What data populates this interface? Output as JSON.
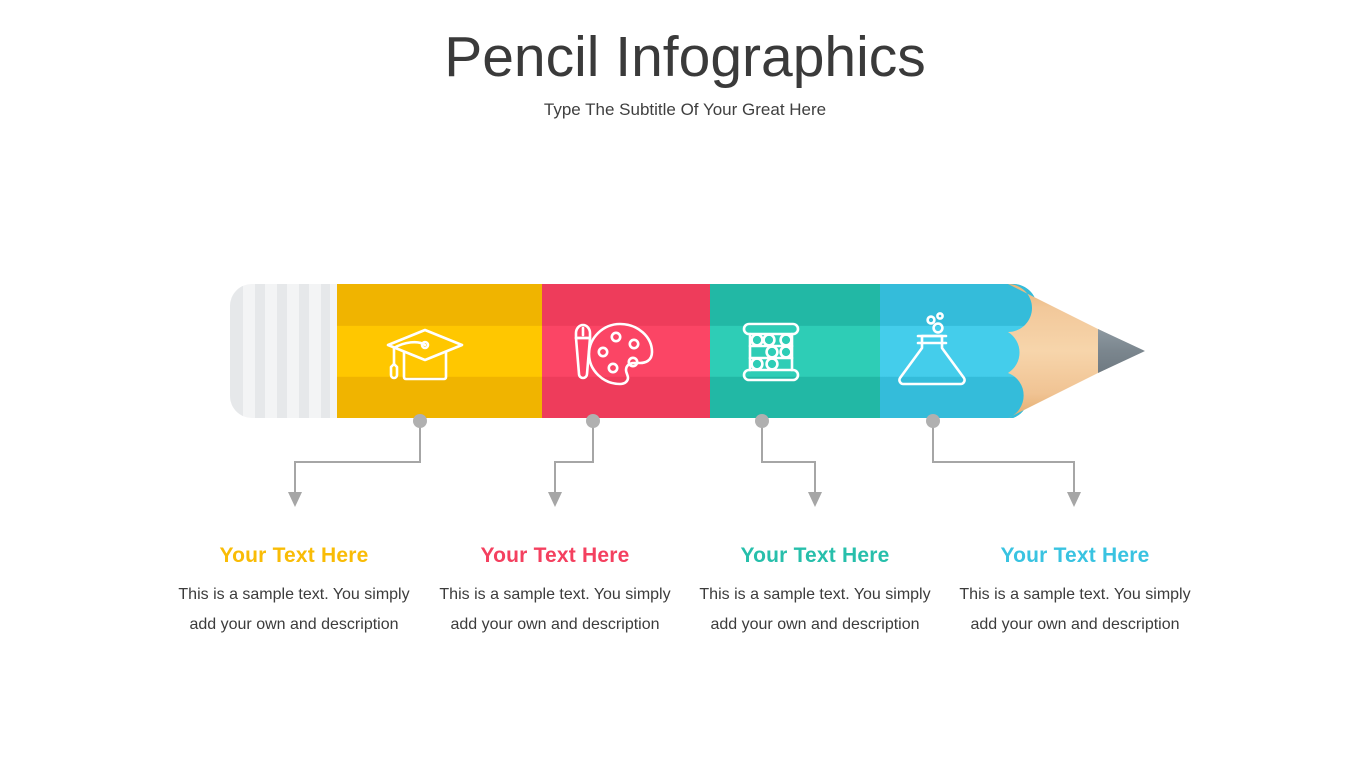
{
  "header": {
    "title": "Pencil Infographics",
    "subtitle": "Type The Subtitle Of Your Great Here"
  },
  "colors": {
    "title_text": "#3a3a3a",
    "subtitle_text": "#3f3f3f",
    "body_text": "#3c3c3c",
    "eraser_light": "#f4f5f6",
    "eraser_dark": "#e2e4e6",
    "yellow": "#f9bc06",
    "yellow_light": "#ffc800",
    "pink": "#f4405f",
    "pink_light": "#fb4363",
    "teal": "#27bfab",
    "teal_light": "#2ecdb6",
    "blue": "#39c3e1",
    "blue_light": "#43cdea",
    "wood": "#efc089",
    "wood_light": "#f6d2a6",
    "graphite": "#7e8b93",
    "connector": "#a6a6a6"
  },
  "pencil": {
    "eraser_label": "pencil-eraser-ferrule",
    "tip_label": "pencil-wood-tip",
    "graphite_label": "pencil-graphite-point",
    "segments": [
      {
        "id": "segment-1",
        "color": "#f9bc06",
        "icon": "graduation-cap-icon"
      },
      {
        "id": "segment-2",
        "color": "#f4405f",
        "icon": "palette-icon"
      },
      {
        "id": "segment-3",
        "color": "#27bfab",
        "icon": "abacus-icon"
      },
      {
        "id": "segment-4",
        "color": "#39c3e1",
        "icon": "flask-icon"
      }
    ]
  },
  "captions": [
    {
      "heading": "Your Text Here",
      "color": "#f9bc06",
      "body": "This is a sample text. You simply add your own and description"
    },
    {
      "heading": "Your Text Here",
      "color": "#f4405f",
      "body": "This is a sample text. You simply add your own and description"
    },
    {
      "heading": "Your Text Here",
      "color": "#27bfab",
      "body": "This is a sample text. You simply add your own and description"
    },
    {
      "heading": "Your Text Here",
      "color": "#39c3e1",
      "body": "This is a sample text. You simply add your own and description"
    }
  ]
}
